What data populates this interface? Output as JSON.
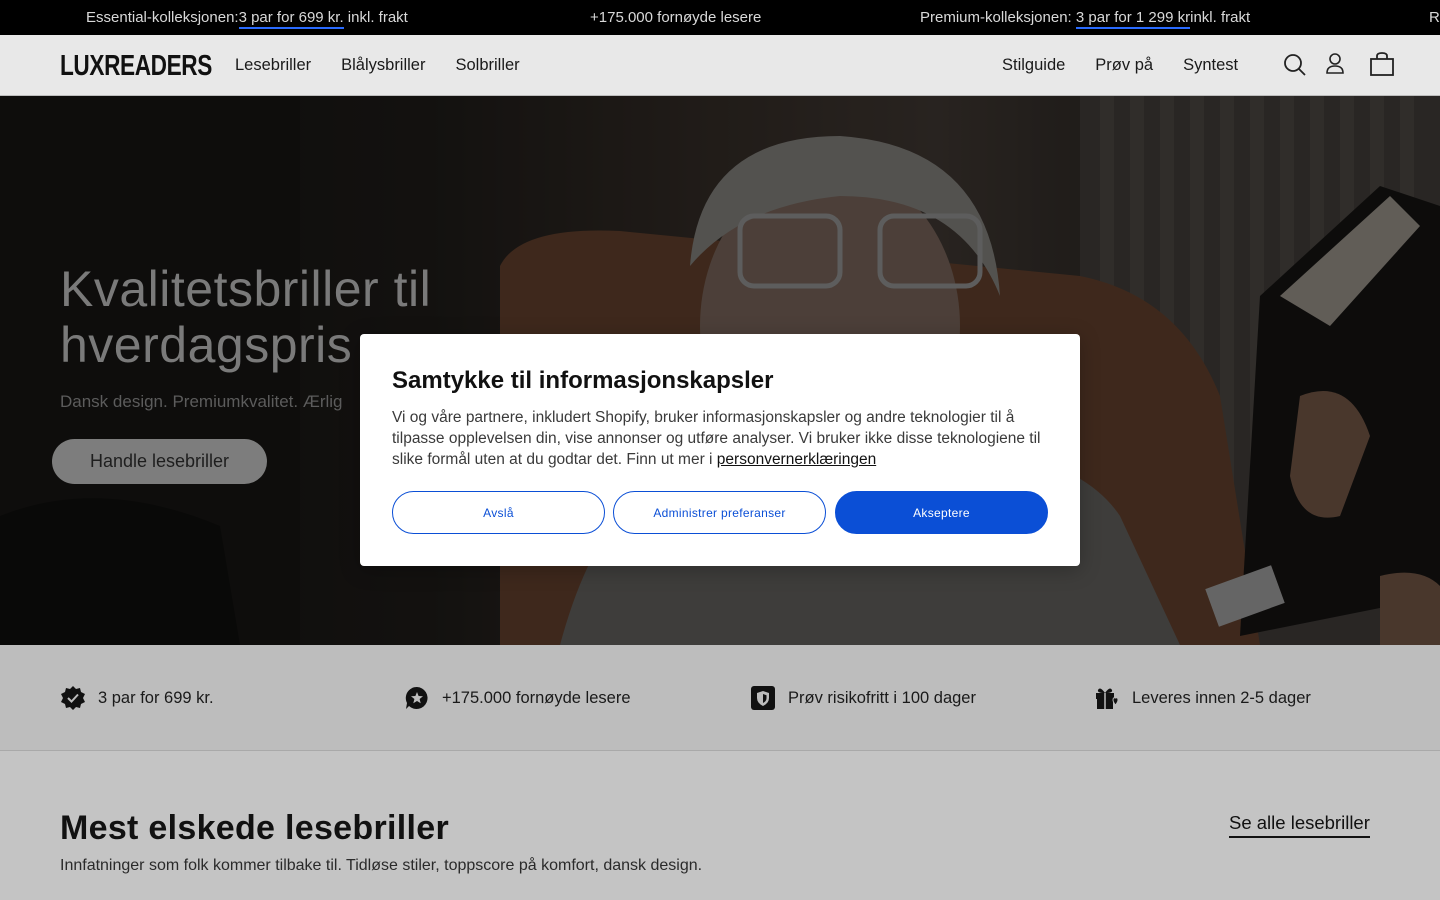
{
  "announcement": {
    "m1_prefix": "Essential-kolleksjonen:",
    "m1_highlight": "3 par for 699 kr.",
    "m1_suffix": " inkl. frakt",
    "m2": "+175.000 fornøyde lesere",
    "m3_prefix": "Premium-kolleksjonen: ",
    "m3_highlight": "3 par for 1 299 kr",
    "m3_suffix": "inkl. frakt",
    "m4": "R"
  },
  "header": {
    "logo": "LUXREADERS",
    "nav_left": [
      "Lesebriller",
      "Blålysbriller",
      "Solbriller"
    ],
    "nav_right": [
      "Stilguide",
      "Prøv på",
      "Syntest"
    ]
  },
  "hero": {
    "title": "Kvalitetsbriller til hverdagspris",
    "subtitle": "Dansk design. Premiumkvalitet. Ærlig",
    "cta": "Handle lesebriller"
  },
  "usps": [
    {
      "icon": "badge-check-icon",
      "text": "3 par for 699 kr."
    },
    {
      "icon": "star-chat-icon",
      "text": "+175.000 fornøyde lesere"
    },
    {
      "icon": "shield-icon",
      "text": "Prøv risikofritt i 100 dager"
    },
    {
      "icon": "gift-heart-icon",
      "text": "Leveres innen 2-5 dager"
    }
  ],
  "section": {
    "title": "Mest elskede lesebriller",
    "subtitle": "Innfatninger som folk kommer tilbake til. Tidløse stiler, toppscore på komfort, dansk design.",
    "link": "Se alle lesebriller"
  },
  "cookie": {
    "title": "Samtykke til informasjonskapsler",
    "body": "Vi og våre partnere, inkludert Shopify, bruker informasjonskapsler og andre teknologier til å tilpasse opplevelsen din, vise annonser og utføre analyser. Vi bruker ikke disse teknologiene til slike formål uten at du godtar det. Finn ut mer i ",
    "link": "personvernerklæringen",
    "decline": "Avslå",
    "manage": "Administrer preferanser",
    "accept": "Akseptere"
  },
  "colors": {
    "accent": "#0b4fd6",
    "announce_bg": "#000000"
  }
}
